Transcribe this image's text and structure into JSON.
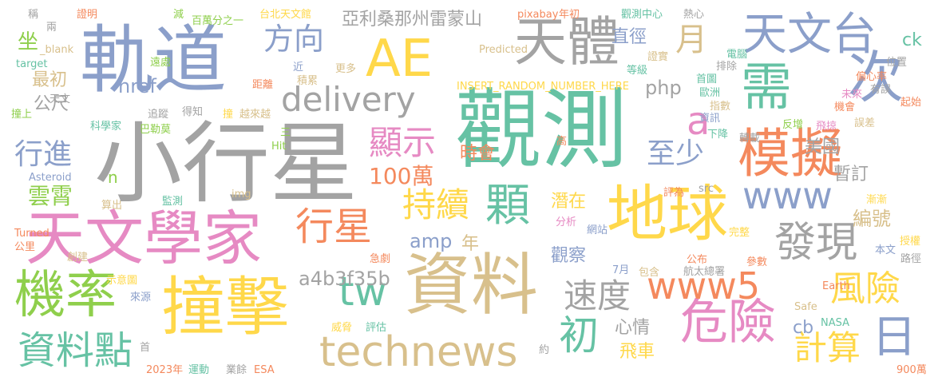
{
  "palette": {
    "gray": "#a3a3a3",
    "orange": "#f4895d",
    "yellow": "#ffd84a",
    "green": "#8fcf4c",
    "blue": "#8b9fca",
    "teal": "#66c2a4",
    "pink": "#e68ac3",
    "tan": "#d8c08c"
  },
  "words": [
    {
      "text": "觀測",
      "color": "#66c2a4"
    },
    {
      "text": "小行星",
      "color": "#a3a3a3"
    },
    {
      "text": "軌道",
      "color": "#8b9fca"
    },
    {
      "text": "天文學家",
      "color": "#e68ac3"
    },
    {
      "text": "撞擊",
      "color": "#ffd84a"
    },
    {
      "text": "資料",
      "color": "#d8c08c"
    },
    {
      "text": "地球",
      "color": "#ffd84a"
    },
    {
      "text": "AE",
      "color": "#ffd84a"
    },
    {
      "text": "天體",
      "color": "#a3a3a3"
    },
    {
      "text": "模擬",
      "color": "#f4895d"
    },
    {
      "text": "需",
      "color": "#66c2a4"
    },
    {
      "text": "次",
      "color": "#8b9fca"
    },
    {
      "text": "天文台",
      "color": "#8b9fca"
    },
    {
      "text": "機率",
      "color": "#8fcf4c"
    },
    {
      "text": "危險",
      "color": "#e68ac3"
    },
    {
      "text": "technews",
      "color": "#d8c08c"
    },
    {
      "text": "delivery",
      "color": "#a3a3a3"
    },
    {
      "text": "顆",
      "color": "#66c2a4"
    },
    {
      "text": "行星",
      "color": "#f4895d"
    },
    {
      "text": "www",
      "color": "#8b9fca"
    },
    {
      "text": "www5",
      "color": "#f4895d"
    },
    {
      "text": "發現",
      "color": "#a3a3a3"
    },
    {
      "text": "資料點",
      "color": "#66c2a4"
    },
    {
      "text": "顯示",
      "color": "#e68ac3"
    },
    {
      "text": "持續",
      "color": "#ffd84a"
    },
    {
      "text": "tw",
      "color": "#66c2a4"
    },
    {
      "text": "初",
      "color": "#66c2a4"
    },
    {
      "text": "日",
      "color": "#8b9fca"
    },
    {
      "text": "月",
      "color": "#d8c08c"
    },
    {
      "text": "方向",
      "color": "#8b9fca"
    },
    {
      "text": "風險",
      "color": "#ffd84a"
    },
    {
      "text": "計算",
      "color": "#ffd84a"
    },
    {
      "text": "速度",
      "color": "#a3a3a3"
    },
    {
      "text": "至少",
      "color": "#8b9fca"
    },
    {
      "text": "100萬",
      "color": "#f4895d"
    },
    {
      "text": "行進",
      "color": "#8b9fca"
    },
    {
      "text": "a",
      "color": "#e68ac3"
    },
    {
      "text": "雲霄",
      "color": "#8fcf4c"
    },
    {
      "text": "亞利桑那州雷蒙山",
      "color": "#a3a3a3"
    },
    {
      "text": "a4b3f35b",
      "color": "#a3a3a3"
    },
    {
      "text": "直徑",
      "color": "#8b9fca"
    },
    {
      "text": "時會",
      "color": "#f4895d"
    },
    {
      "text": "美國",
      "color": "#a3a3a3"
    },
    {
      "text": "暫訂",
      "color": "#a3a3a3"
    },
    {
      "text": "編號",
      "color": "#d8c08c"
    },
    {
      "text": "href",
      "color": "#8b9fca"
    },
    {
      "text": "php",
      "color": "#a3a3a3"
    },
    {
      "text": "amp",
      "color": "#8b9fca"
    },
    {
      "text": "潛在",
      "color": "#ffd84a"
    },
    {
      "text": "觀察",
      "color": "#8b9fca"
    },
    {
      "text": "心情",
      "color": "#a3a3a3"
    },
    {
      "text": "飛車",
      "color": "#ffd84a"
    },
    {
      "text": "年",
      "color": "#d8c08c"
    },
    {
      "text": "坐",
      "color": "#8fcf4c"
    },
    {
      "text": "公尺",
      "color": "#a3a3a3"
    },
    {
      "text": "最初",
      "color": "#d8c08c"
    },
    {
      "text": "ck",
      "color": "#66c2a4"
    },
    {
      "text": "cb",
      "color": "#8b9fca"
    },
    {
      "text": "n",
      "color": "#8fcf4c"
    },
    {
      "text": "2023年",
      "color": "#f4895d"
    },
    {
      "text": "台北天文館",
      "color": "#ffd84a"
    },
    {
      "text": "pixabay",
      "color": "#f4895d"
    },
    {
      "text": "年初",
      "color": "#f4895d"
    },
    {
      "text": "觀測中心",
      "color": "#66c2a4"
    },
    {
      "text": "熱心",
      "color": "#a3a3a3"
    },
    {
      "text": "百萬分之一",
      "color": "#8fcf4c"
    },
    {
      "text": "INSERT_RANDOM_NUMBER_HERE",
      "color": "#ffd84a"
    },
    {
      "text": "Predicted",
      "color": "#d8c08c"
    },
    {
      "text": "Asteroid",
      "color": "#8b9fca"
    },
    {
      "text": "Turned",
      "color": "#f4895d"
    },
    {
      "text": "target",
      "color": "#66c2a4"
    },
    {
      "text": "_blank",
      "color": "#d8c08c"
    },
    {
      "text": "Earth",
      "color": "#f4895d"
    },
    {
      "text": "Safe",
      "color": "#d8c08c"
    },
    {
      "text": "NASA",
      "color": "#66c2a4"
    },
    {
      "text": "ESA",
      "color": "#f4895d"
    },
    {
      "text": "Hit",
      "color": "#8fcf4c"
    },
    {
      "text": "img",
      "color": "#d8c08c"
    },
    {
      "text": "src",
      "color": "#a3a3a3"
    },
    {
      "text": "900萬",
      "color": "#f4895d"
    },
    {
      "text": "稱",
      "color": "#a3a3a3"
    },
    {
      "text": "證明",
      "color": "#f4895d"
    },
    {
      "text": "減",
      "color": "#8fcf4c"
    },
    {
      "text": "兩",
      "color": "#a3a3a3"
    },
    {
      "text": "遠處",
      "color": "#8fcf4c"
    },
    {
      "text": "等級",
      "color": "#66c2a4"
    },
    {
      "text": "證實",
      "color": "#d8c08c"
    },
    {
      "text": "電腦",
      "color": "#66c2a4"
    },
    {
      "text": "位置",
      "color": "#a3a3a3"
    },
    {
      "text": "偏心率",
      "color": "#f4895d"
    },
    {
      "text": "有誤",
      "color": "#a3a3a3"
    },
    {
      "text": "起始",
      "color": "#f4895d"
    },
    {
      "text": "首圖",
      "color": "#66c2a4"
    },
    {
      "text": "歐洲",
      "color": "#66c2a4"
    },
    {
      "text": "未來",
      "color": "#e68ac3"
    },
    {
      "text": "機會",
      "color": "#f4895d"
    },
    {
      "text": "指數",
      "color": "#d8c08c"
    },
    {
      "text": "排除",
      "color": "#a3a3a3"
    },
    {
      "text": "資訊",
      "color": "#8b9fca"
    },
    {
      "text": "誤差",
      "color": "#d8c08c"
    },
    {
      "text": "飛掠",
      "color": "#e68ac3"
    },
    {
      "text": "反增",
      "color": "#8fcf4c"
    },
    {
      "text": "下降",
      "color": "#66c2a4"
    },
    {
      "text": "轉載",
      "color": "#a3a3a3"
    },
    {
      "text": "近",
      "color": "#8b9fca"
    },
    {
      "text": "更多",
      "color": "#d8c08c"
    },
    {
      "text": "積累",
      "color": "#d8c08c"
    },
    {
      "text": "天文",
      "color": "#a3a3a3"
    },
    {
      "text": "距離",
      "color": "#f4895d"
    },
    {
      "text": "撞上",
      "color": "#8fcf4c"
    },
    {
      "text": "追蹤",
      "color": "#a3a3a3"
    },
    {
      "text": "得知",
      "color": "#a3a3a3"
    },
    {
      "text": "撞",
      "color": "#ffd84a"
    },
    {
      "text": "越來越",
      "color": "#d8c08c"
    },
    {
      "text": "科學家",
      "color": "#66c2a4"
    },
    {
      "text": "巴勒莫",
      "color": "#8fcf4c"
    },
    {
      "text": "高",
      "color": "#f4895d"
    },
    {
      "text": "三",
      "color": "#8fcf4c"
    },
    {
      "text": "監測",
      "color": "#66c2a4"
    },
    {
      "text": "算出",
      "color": "#d8c08c"
    },
    {
      "text": "評為",
      "color": "#f4895d"
    },
    {
      "text": "漸漸",
      "color": "#ffd84a"
    },
    {
      "text": "分析",
      "color": "#e68ac3"
    },
    {
      "text": "網站",
      "color": "#8b9fca"
    },
    {
      "text": "完整",
      "color": "#ffd84a"
    },
    {
      "text": "授權",
      "color": "#ffd84a"
    },
    {
      "text": "本文",
      "color": "#8b9fca"
    },
    {
      "text": "路徑",
      "color": "#a3a3a3"
    },
    {
      "text": "公里",
      "color": "#f4895d"
    },
    {
      "text": "創建",
      "color": "#d8c08c"
    },
    {
      "text": "急劇",
      "color": "#f4895d"
    },
    {
      "text": "7月",
      "color": "#8b9fca"
    },
    {
      "text": "包含",
      "color": "#d8c08c"
    },
    {
      "text": "公布",
      "color": "#f4895d"
    },
    {
      "text": "參數",
      "color": "#f4895d"
    },
    {
      "text": "航太總署",
      "color": "#a3a3a3"
    },
    {
      "text": "示意圖",
      "color": "#ffd84a"
    },
    {
      "text": "來源",
      "color": "#8b9fca"
    },
    {
      "text": "威脅",
      "color": "#ffd84a"
    },
    {
      "text": "評估",
      "color": "#66c2a4"
    },
    {
      "text": "首",
      "color": "#a3a3a3"
    },
    {
      "text": "運動",
      "color": "#66c2a4"
    },
    {
      "text": "業餘",
      "color": "#a3a3a3"
    },
    {
      "text": "約",
      "color": "#a3a3a3"
    }
  ]
}
